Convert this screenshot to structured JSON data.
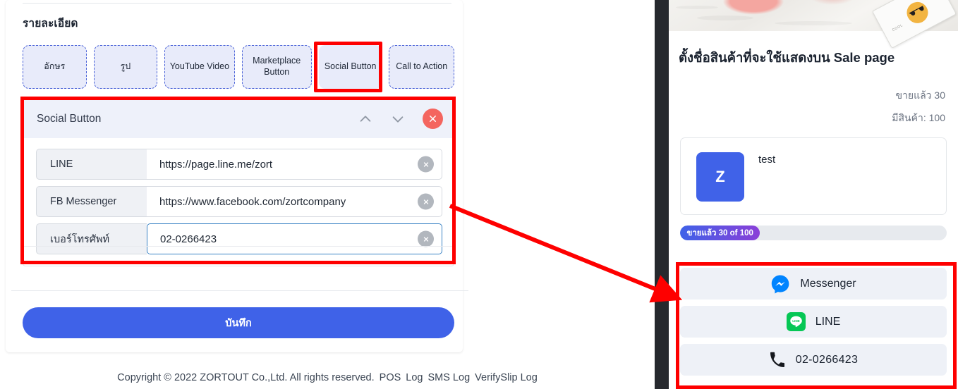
{
  "editor": {
    "section_title": "รายละเอียด",
    "chips": [
      {
        "label": "อักษร",
        "selected": false
      },
      {
        "label": "รูป",
        "selected": false
      },
      {
        "label": "YouTube Video",
        "selected": false
      },
      {
        "label": "Marketplace Button",
        "selected": false
      },
      {
        "label": "Social Button",
        "selected": true
      },
      {
        "label": "Call to Action",
        "selected": false
      }
    ],
    "social_block": {
      "title": "Social Button",
      "move_up_icon": "chevron-up-icon",
      "move_down_icon": "chevron-down-icon",
      "close_icon": "close-icon",
      "rows": [
        {
          "label": "LINE",
          "value": "https://page.line.me/zort",
          "placeholder": "",
          "focused": false
        },
        {
          "label": "FB Messenger",
          "value": "https://www.facebook.com/zortcompany",
          "placeholder": "",
          "focused": false
        },
        {
          "label": "เบอร์โทรศัพท์",
          "value": "02-0266423",
          "placeholder": "",
          "focused": true
        }
      ]
    },
    "save_label": "บันทึก"
  },
  "footer": {
    "copyright": "Copyright © 2022 ZORTOUT Co.,Ltd. All rights reserved.",
    "links": [
      "POS",
      "Log",
      "SMS Log",
      "VerifySlip Log"
    ]
  },
  "preview": {
    "product_title": "ตั้งชื่อสินค้าที่จะใช้แสดงบน Sale page",
    "sold_line": "ขายแล้ว 30",
    "stock_line": "มีสินค้า: 100",
    "product_card": {
      "thumb_letter": "Z",
      "name": "test"
    },
    "progress": {
      "label": "ขายแล้ว 30 of 100",
      "sold": 30,
      "total": 100,
      "percent": 30
    },
    "social_buttons": [
      {
        "label": "Messenger",
        "icon": "messenger-icon"
      },
      {
        "label": "LINE",
        "icon": "line-icon"
      },
      {
        "label": "02-0266423",
        "icon": "phone-icon"
      }
    ],
    "hero_card_caption": "COOL"
  },
  "colors": {
    "accent_blue": "#3f62e8",
    "chip_bg": "#e8ebfa",
    "chip_border": "#4a62d8",
    "annotation_red": "#fe0000",
    "close_red": "#f4655f",
    "messenger_blue": "#0084ff",
    "line_green": "#06c755",
    "progress_start": "#3f62e8",
    "progress_end": "#8a3fd8"
  }
}
